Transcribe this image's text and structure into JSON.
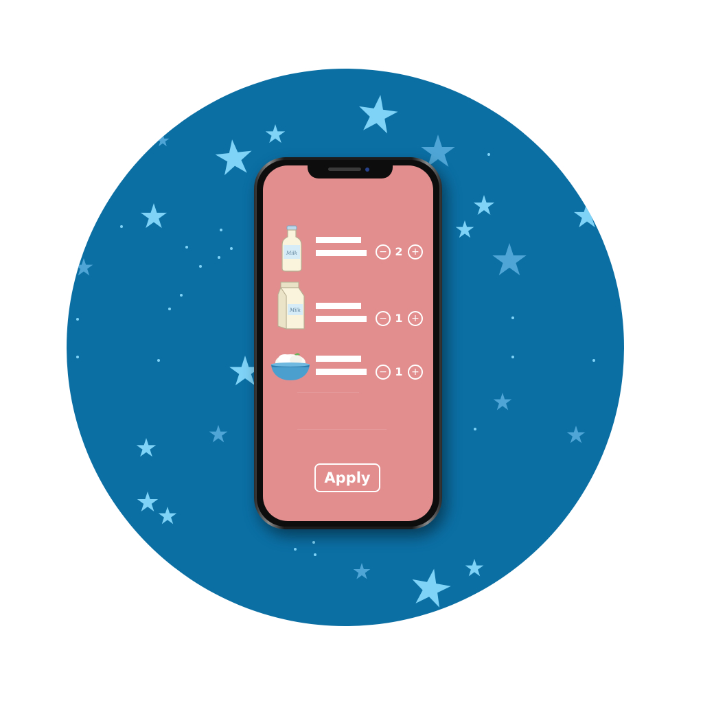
{
  "app": {
    "background_color": "#0b6fa4",
    "star_colors": [
      "#7fd3f7",
      "#5fb8e6"
    ],
    "screen_color": "#e28e8f"
  },
  "items": [
    {
      "icon": "milk-bottle-icon",
      "icon_text": "Milk",
      "quantity": "2"
    },
    {
      "icon": "milk-carton-icon",
      "icon_text": "Milk",
      "quantity": "1"
    },
    {
      "icon": "yogurt-bowl-icon",
      "quantity": "1"
    }
  ],
  "stepper": {
    "minus_symbol": "−",
    "plus_symbol": "+"
  },
  "apply_button": {
    "label": "Apply"
  }
}
